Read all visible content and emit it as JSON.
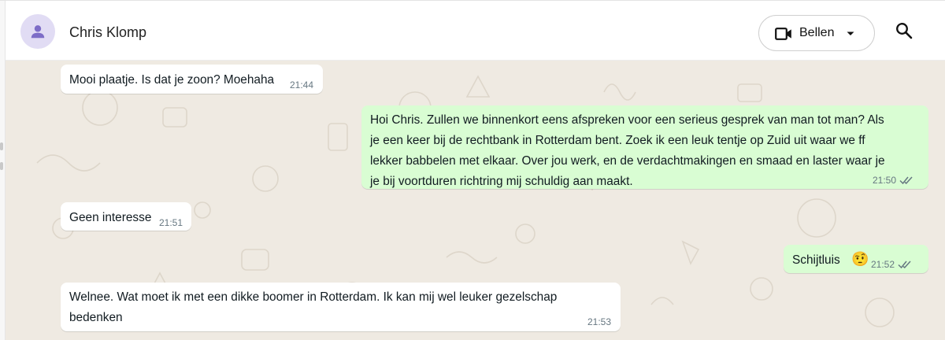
{
  "contact": {
    "name": "Chris Klomp"
  },
  "header": {
    "call_label": "Bellen"
  },
  "icons": {
    "avatar": "person-icon",
    "video": "video-camera-icon",
    "dropdown": "chevron-down-icon",
    "search": "search-icon",
    "read": "double-check-icon"
  },
  "colors": {
    "incoming_bubble": "#ffffff",
    "outgoing_bubble": "#d9fdd3",
    "chat_background": "#efeae2",
    "avatar_bg": "#e1dcf4",
    "avatar_icon": "#7d6dc7",
    "read_ticks": "#53bdeb"
  },
  "messages": [
    {
      "direction": "in",
      "lines": [
        "Mooi plaatje. Is dat je zoon? Moehaha"
      ],
      "time": "21:44"
    },
    {
      "direction": "out",
      "lines": [
        "Hoi Chris. Zullen we binnenkort eens afspreken voor een serieus gesprek van man tot man? Als",
        "je een keer bij de rechtbank in Rotterdam bent. Zoek ik een leuk tentje op Zuid uit waar we ff",
        "lekker babbelen met elkaar. Over jou werk, en de verdachtmakingen en smaad en laster waar je",
        "je bij voortduren richtring mij schuldig aan maakt."
      ],
      "time": "21:50",
      "status": "read"
    },
    {
      "direction": "in",
      "lines": [
        "Geen interesse"
      ],
      "time": "21:51"
    },
    {
      "direction": "out",
      "lines": [
        "Schijtluis"
      ],
      "emoji": "🤨",
      "time": "21:52",
      "status": "read"
    },
    {
      "direction": "in",
      "lines": [
        "Welnee. Wat moet ik met een dikke boomer in Rotterdam. Ik kan mij wel leuker gezelschap",
        "bedenken"
      ],
      "time": "21:53"
    }
  ]
}
